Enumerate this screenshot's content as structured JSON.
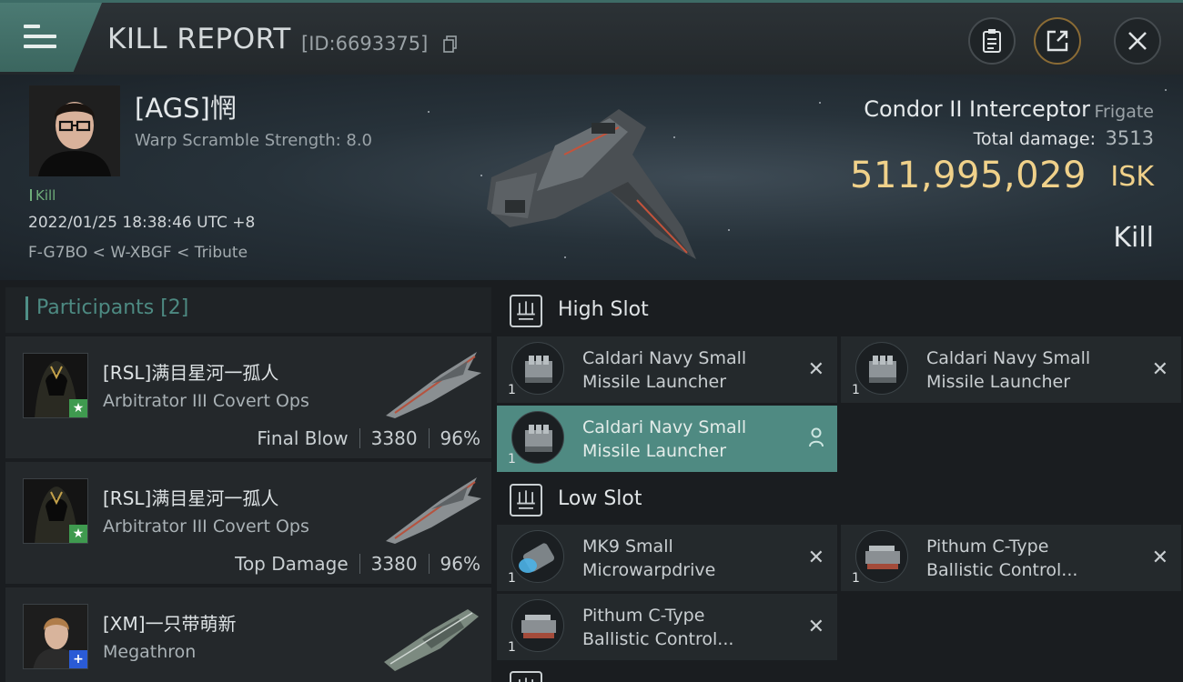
{
  "header": {
    "title": "KILL REPORT",
    "kill_id": "[ID:6693375]",
    "icons": [
      "menu-icon",
      "copy-icon",
      "clipboard-icon",
      "share-icon",
      "close-icon"
    ]
  },
  "victim": {
    "pilot": "[AGS]惘",
    "warp_scramble": "Warp Scramble Strength: 8.0",
    "tag": "Kill",
    "timestamp": "2022/01/25 18:38:46 UTC +8",
    "location": "F-G7BO < W-XBGF < Tribute",
    "ship_name": "Condor II Interceptor",
    "ship_class": "Frigate",
    "total_damage_label": "Total damage:",
    "total_damage": "3513",
    "isk_value": "511,995,029",
    "isk_unit": "ISK",
    "result": "Kill"
  },
  "participants": {
    "title": "Participants [2]",
    "items": [
      {
        "name": "[RSL]满目星河一孤人",
        "ship": "Arbitrator III Covert Ops",
        "role": "Final Blow",
        "damage": "3380",
        "percent": "96%",
        "badge": "★"
      },
      {
        "name": "[RSL]满目星河一孤人",
        "ship": "Arbitrator III Covert Ops",
        "role": "Top Damage",
        "damage": "3380",
        "percent": "96%",
        "badge": "★"
      },
      {
        "name": "[XM]一只带萌新",
        "ship": "Megathron",
        "badge": "+"
      }
    ]
  },
  "slots": {
    "high": {
      "label": "High Slot",
      "modules": [
        {
          "line1": "Caldari Navy Small",
          "line2": "Missile Launcher",
          "qty": "1",
          "status": "destroyed"
        },
        {
          "line1": "Caldari Navy Small",
          "line2": "Missile Launcher",
          "qty": "1",
          "status": "destroyed"
        },
        {
          "line1": "Caldari Navy Small",
          "line2": "Missile Launcher",
          "qty": "1",
          "status": "dropped"
        }
      ]
    },
    "low": {
      "label": "Low Slot",
      "modules": [
        {
          "line1": "MK9 Small",
          "line2": "Microwarpdrive",
          "qty": "1",
          "status": "destroyed"
        },
        {
          "line1": "Pithum C-Type",
          "line2": "Ballistic Control...",
          "qty": "1",
          "status": "destroyed"
        },
        {
          "line1": "Pithum C-Type",
          "line2": "Ballistic Control...",
          "qty": "1",
          "status": "destroyed"
        }
      ]
    },
    "destroyed_glyph": "✕"
  },
  "colors": {
    "accent": "#4f8a82",
    "isk": "#f0d18a",
    "kill_tag": "#6fae7a"
  }
}
